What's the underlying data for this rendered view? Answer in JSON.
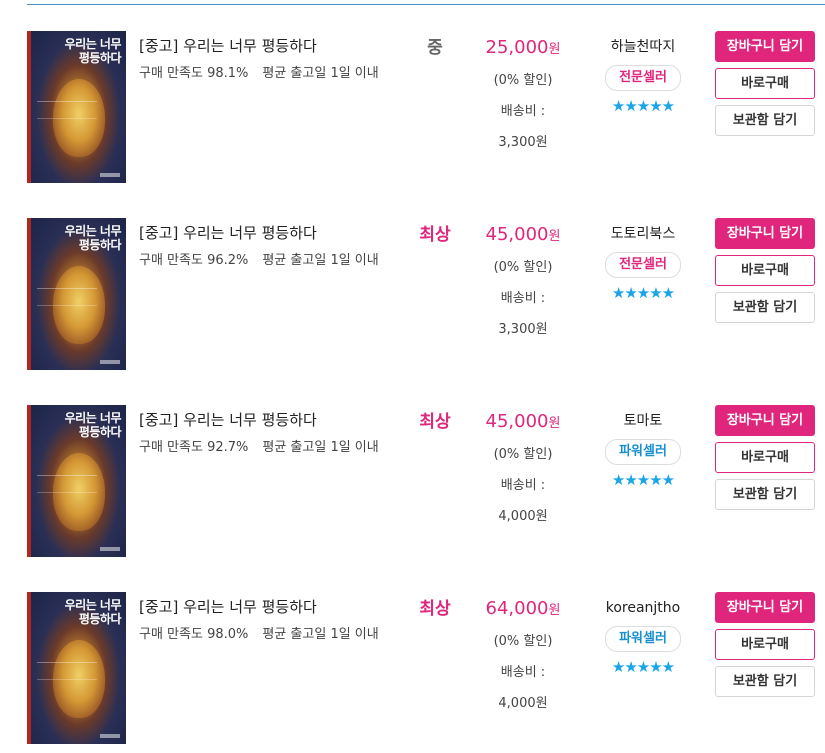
{
  "colors": {
    "accent": "#e0267c",
    "grade_high": "#e0267c",
    "grade_mid": "#666666",
    "star": "#1aa5e8",
    "badge_expert": "#e0267c",
    "badge_power": "#1a8fd0"
  },
  "cover_title": "우리는 너무 평등하다",
  "listings": [
    {
      "title": "[중고] 우리는 너무 평등하다",
      "satisfaction": "구매 만족도 98.1%",
      "shipping_avg": "평균 출고일 1일 이내",
      "grade": "중",
      "grade_level": "mid",
      "price": "25,000",
      "won": "원",
      "discount": "(0% 할인)",
      "shipping_label": "배송비 :",
      "shipping_fee": "3,300원",
      "seller": "하늘천따지",
      "badge": "전문셀러",
      "badge_type": "expert",
      "stars": "★★★★★",
      "rating": 5,
      "cart_label": "장바구니 담기",
      "buy_label": "바로구매",
      "save_label": "보관함 담기"
    },
    {
      "title": "[중고] 우리는 너무 평등하다",
      "satisfaction": "구매 만족도 96.2%",
      "shipping_avg": "평균 출고일 1일 이내",
      "grade": "최상",
      "grade_level": "high",
      "price": "45,000",
      "won": "원",
      "discount": "(0% 할인)",
      "shipping_label": "배송비 :",
      "shipping_fee": "3,300원",
      "seller": "도토리북스",
      "badge": "전문셀러",
      "badge_type": "expert",
      "stars": "★★★★★",
      "rating": 5,
      "cart_label": "장바구니 담기",
      "buy_label": "바로구매",
      "save_label": "보관함 담기"
    },
    {
      "title": "[중고] 우리는 너무 평등하다",
      "satisfaction": "구매 만족도 92.7%",
      "shipping_avg": "평균 출고일 1일 이내",
      "grade": "최상",
      "grade_level": "high",
      "price": "45,000",
      "won": "원",
      "discount": "(0% 할인)",
      "shipping_label": "배송비 :",
      "shipping_fee": "4,000원",
      "seller": "토마토",
      "badge": "파워셀러",
      "badge_type": "power",
      "stars": "★★★★★",
      "rating": 5,
      "cart_label": "장바구니 담기",
      "buy_label": "바로구매",
      "save_label": "보관함 담기"
    },
    {
      "title": "[중고] 우리는 너무 평등하다",
      "satisfaction": "구매 만족도 98.0%",
      "shipping_avg": "평균 출고일 1일 이내",
      "grade": "최상",
      "grade_level": "high",
      "price": "64,000",
      "won": "원",
      "discount": "(0% 할인)",
      "shipping_label": "배송비 :",
      "shipping_fee": "4,000원",
      "seller": "koreanjtho",
      "badge": "파워셀러",
      "badge_type": "power",
      "stars": "★★★★★",
      "rating": 5,
      "cart_label": "장바구니 담기",
      "buy_label": "바로구매",
      "save_label": "보관함 담기"
    }
  ]
}
